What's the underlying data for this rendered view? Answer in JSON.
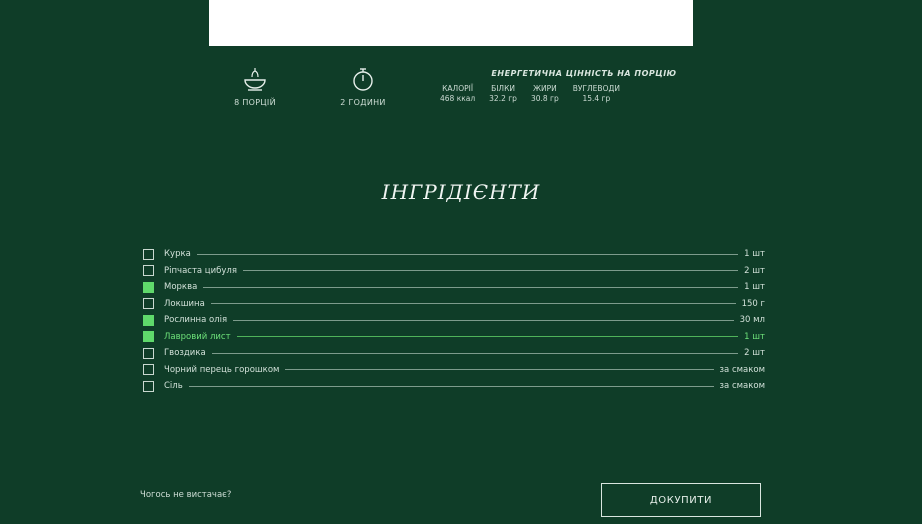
{
  "meta": {
    "servings_label": "8 ПОРЦІЙ",
    "time_label": "2 ГОДИНИ"
  },
  "energy": {
    "title": "ЕНЕРГЕТИЧНА ЦІННІСТЬ НА ПОРЦІЮ",
    "items": [
      {
        "label": "КАЛОРІЇ",
        "value": "468 ккал"
      },
      {
        "label": "БІЛКИ",
        "value": "32.2 гр"
      },
      {
        "label": "ЖИРИ",
        "value": "30.8 гр"
      },
      {
        "label": "ВУГЛЕВОДИ",
        "value": "15.4 гр"
      }
    ]
  },
  "ingredients_title": "ІНГРІДІЄНТИ",
  "ingredients": [
    {
      "name": "Курка",
      "qty": "1 шт",
      "checked": false,
      "highlight": false
    },
    {
      "name": "Ріпчаста цибуля",
      "qty": "2 шт",
      "checked": false,
      "highlight": false
    },
    {
      "name": "Морква",
      "qty": "1 шт",
      "checked": true,
      "highlight": false
    },
    {
      "name": "Локшина",
      "qty": "150 г",
      "checked": false,
      "highlight": false
    },
    {
      "name": "Рослинна олія",
      "qty": "30 мл",
      "checked": true,
      "highlight": false
    },
    {
      "name": "Лавровий лист",
      "qty": "1 шт",
      "checked": true,
      "highlight": true
    },
    {
      "name": "Гвоздика",
      "qty": "2 шт",
      "checked": false,
      "highlight": false
    },
    {
      "name": "Чорний перець горошком",
      "qty": "за смаком",
      "checked": false,
      "highlight": false
    },
    {
      "name": "Сіль",
      "qty": "за смаком",
      "checked": false,
      "highlight": false
    }
  ],
  "footer": {
    "missing_text": "Чогось не вистачає?",
    "buy_label": "ДОКУПИТИ"
  },
  "colors": {
    "background": "#0f3d28",
    "accent": "#5fd96b"
  }
}
